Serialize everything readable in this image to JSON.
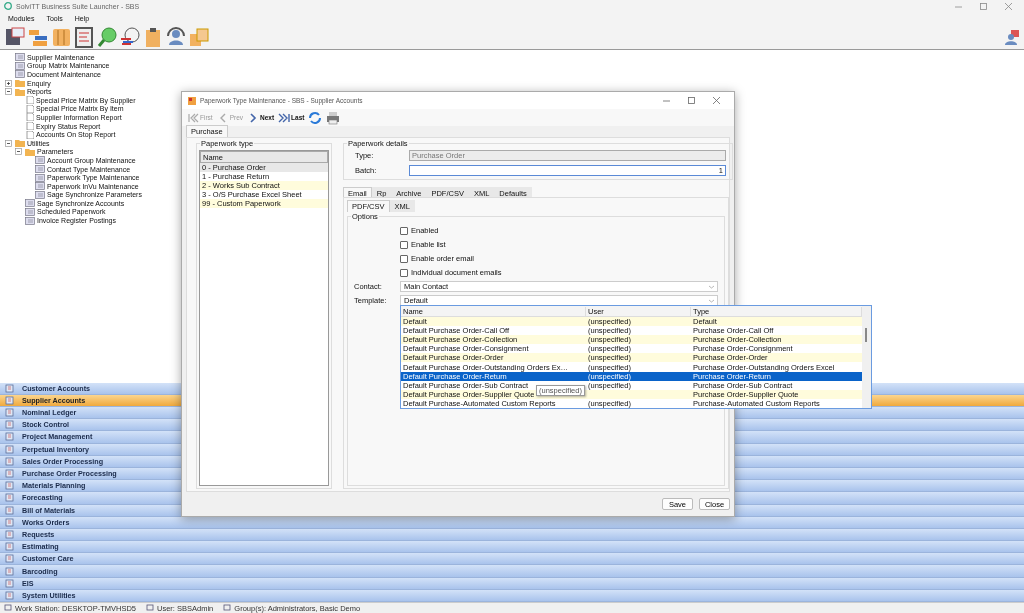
{
  "window": {
    "title": "SolviTT Business Suite Launcher - SBS"
  },
  "menu": [
    "Modules",
    "Tools",
    "Help"
  ],
  "tree": [
    {
      "label": "Supplier Maintenance",
      "kind": "form"
    },
    {
      "label": "Group Matrix Maintenance",
      "kind": "form"
    },
    {
      "label": "Document Maintenance",
      "kind": "form"
    },
    {
      "label": "Enquiry",
      "kind": "folder",
      "expanded": false
    },
    {
      "label": "Reports",
      "kind": "folder",
      "expanded": true,
      "children": [
        {
          "label": "Special Price Matrix By Supplier",
          "kind": "report"
        },
        {
          "label": "Special Price Matrix By Item",
          "kind": "report"
        },
        {
          "label": "Supplier Information Report",
          "kind": "report"
        },
        {
          "label": "Expiry Status Report",
          "kind": "report"
        },
        {
          "label": "Accounts On Stop Report",
          "kind": "report"
        }
      ]
    },
    {
      "label": "Utilities",
      "kind": "folder",
      "expanded": true,
      "children": [
        {
          "label": "Parameters",
          "kind": "folder",
          "expanded": true,
          "children": [
            {
              "label": "Account Group Maintenance",
              "kind": "form"
            },
            {
              "label": "Contact Type Maintenance",
              "kind": "form"
            },
            {
              "label": "Paperwork Type Maintenance",
              "kind": "form"
            },
            {
              "label": "Paperwork InVu Maintenance",
              "kind": "form"
            },
            {
              "label": "Sage Synchronize Parameters",
              "kind": "form"
            }
          ]
        },
        {
          "label": "Sage Synchronize Accounts",
          "kind": "form"
        },
        {
          "label": "Scheduled Paperwork",
          "kind": "form"
        },
        {
          "label": "Invoice Register Postings",
          "kind": "form"
        }
      ]
    }
  ],
  "nav": [
    {
      "label": "Customer Accounts",
      "selected": false
    },
    {
      "label": "Supplier Accounts",
      "selected": true
    },
    {
      "label": "Nominal Ledger",
      "selected": false
    },
    {
      "label": "Stock Control",
      "selected": false
    },
    {
      "label": "Project Management",
      "selected": false
    },
    {
      "label": "Perpetual Inventory",
      "selected": false
    },
    {
      "label": "Sales Order Processing",
      "selected": false
    },
    {
      "label": "Purchase Order Processing",
      "selected": false
    },
    {
      "label": "Materials Planning",
      "selected": false
    },
    {
      "label": "Forecasting",
      "selected": false
    },
    {
      "label": "Bill of Materials",
      "selected": false
    },
    {
      "label": "Works Orders",
      "selected": false
    },
    {
      "label": "Requests",
      "selected": false
    },
    {
      "label": "Estimating",
      "selected": false
    },
    {
      "label": "Customer Care",
      "selected": false
    },
    {
      "label": "Barcoding",
      "selected": false
    },
    {
      "label": "EIS",
      "selected": false
    },
    {
      "label": "System Utilities",
      "selected": false
    }
  ],
  "status_bar": [
    "Work Station: DESKTOP-TMVHSD5",
    "User: SBSAdmin",
    "Group(s): Administrators, Basic Demo"
  ],
  "dialog": {
    "title": "Paperwork Type Maintenance - SBS - Supplier Accounts",
    "toolbar": [
      {
        "label": "First",
        "kind": "first",
        "disabled": true
      },
      {
        "label": "Prev",
        "kind": "prev",
        "disabled": true
      },
      {
        "label": "Next",
        "kind": "next",
        "disabled": false
      },
      {
        "label": "Last",
        "kind": "last",
        "disabled": false
      }
    ],
    "tabs": [
      {
        "label": "Purchase",
        "selected": true
      }
    ],
    "paperwork_type": {
      "title": "Paperwork type",
      "column": "Name",
      "rows": [
        {
          "label": "0 - Purchase Order",
          "selected": true
        },
        {
          "label": "1 - Purchase Return",
          "selected": false
        },
        {
          "label": "2 - Works Sub Contract",
          "selected": false
        },
        {
          "label": "3 - O/S Purchase Excel Sheet",
          "selected": false
        },
        {
          "label": "99 - Custom Paperwork",
          "selected": false
        }
      ]
    },
    "details": {
      "title": "Paperwork details",
      "type_label": "Type:",
      "type_value": "Purchase Order",
      "batch_label": "Batch:",
      "batch_value": "1"
    },
    "tabs2": [
      {
        "label": "Email",
        "selected": true
      },
      {
        "label": "Rp",
        "selected": false
      },
      {
        "label": "Archive",
        "selected": false
      },
      {
        "label": "PDF/CSV",
        "selected": false
      },
      {
        "label": "XML",
        "selected": false
      },
      {
        "label": "Defaults",
        "selected": false
      }
    ],
    "subtabs": [
      {
        "label": "PDF/CSV",
        "selected": true
      },
      {
        "label": "XML",
        "selected": false
      }
    ],
    "options_title": "Options",
    "checkboxes": [
      {
        "label": "Enabled",
        "checked": false
      },
      {
        "label": "Enable list",
        "checked": false
      },
      {
        "label": "Enable order email",
        "checked": false
      },
      {
        "label": "Individual document emails",
        "checked": false
      }
    ],
    "contact": {
      "label": "Contact:",
      "value": "Main Contact"
    },
    "template": {
      "label": "Template:",
      "value": "Default"
    },
    "template_list": {
      "columns": [
        "Name",
        "User",
        "Type"
      ],
      "rows": [
        {
          "name": "Default",
          "user": "(unspecified)",
          "type": "Default",
          "selected": false
        },
        {
          "name": "Default Purchase Order-Call Off",
          "user": "(unspecified)",
          "type": "Purchase Order-Call Off",
          "selected": false
        },
        {
          "name": "Default Purchase Order-Collection",
          "user": "(unspecified)",
          "type": "Purchase Order-Collection",
          "selected": false
        },
        {
          "name": "Default Purchase Order-Consignment",
          "user": "(unspecified)",
          "type": "Purchase Order-Consignment",
          "selected": false
        },
        {
          "name": "Default Purchase Order-Order",
          "user": "(unspecified)",
          "type": "Purchase Order-Order",
          "selected": false
        },
        {
          "name": "Default Purchase Order-Outstanding Orders Ex…",
          "user": "(unspecified)",
          "type": "Purchase Order-Outstanding Orders Excel",
          "selected": false
        },
        {
          "name": "Default Purchase Order-Return",
          "user": "(unspecified)",
          "type": "Purchase Order-Return",
          "selected": true
        },
        {
          "name": "Default Purchase Order-Sub Contract",
          "user": "(unspecified)",
          "type": "Purchase Order-Sub Contract",
          "selected": false
        },
        {
          "name": "Default Purchase Order-Supplier Quote",
          "user": "",
          "type": "Purchase Order-Supplier Quote",
          "selected": false
        },
        {
          "name": "Default Purchase-Automated Custom Reports",
          "user": "(unspecified)",
          "type": "Purchase-Automated Custom Reports",
          "selected": false
        }
      ],
      "tooltip": "(unspecified)"
    },
    "buttons": [
      "Save",
      "Close"
    ]
  }
}
